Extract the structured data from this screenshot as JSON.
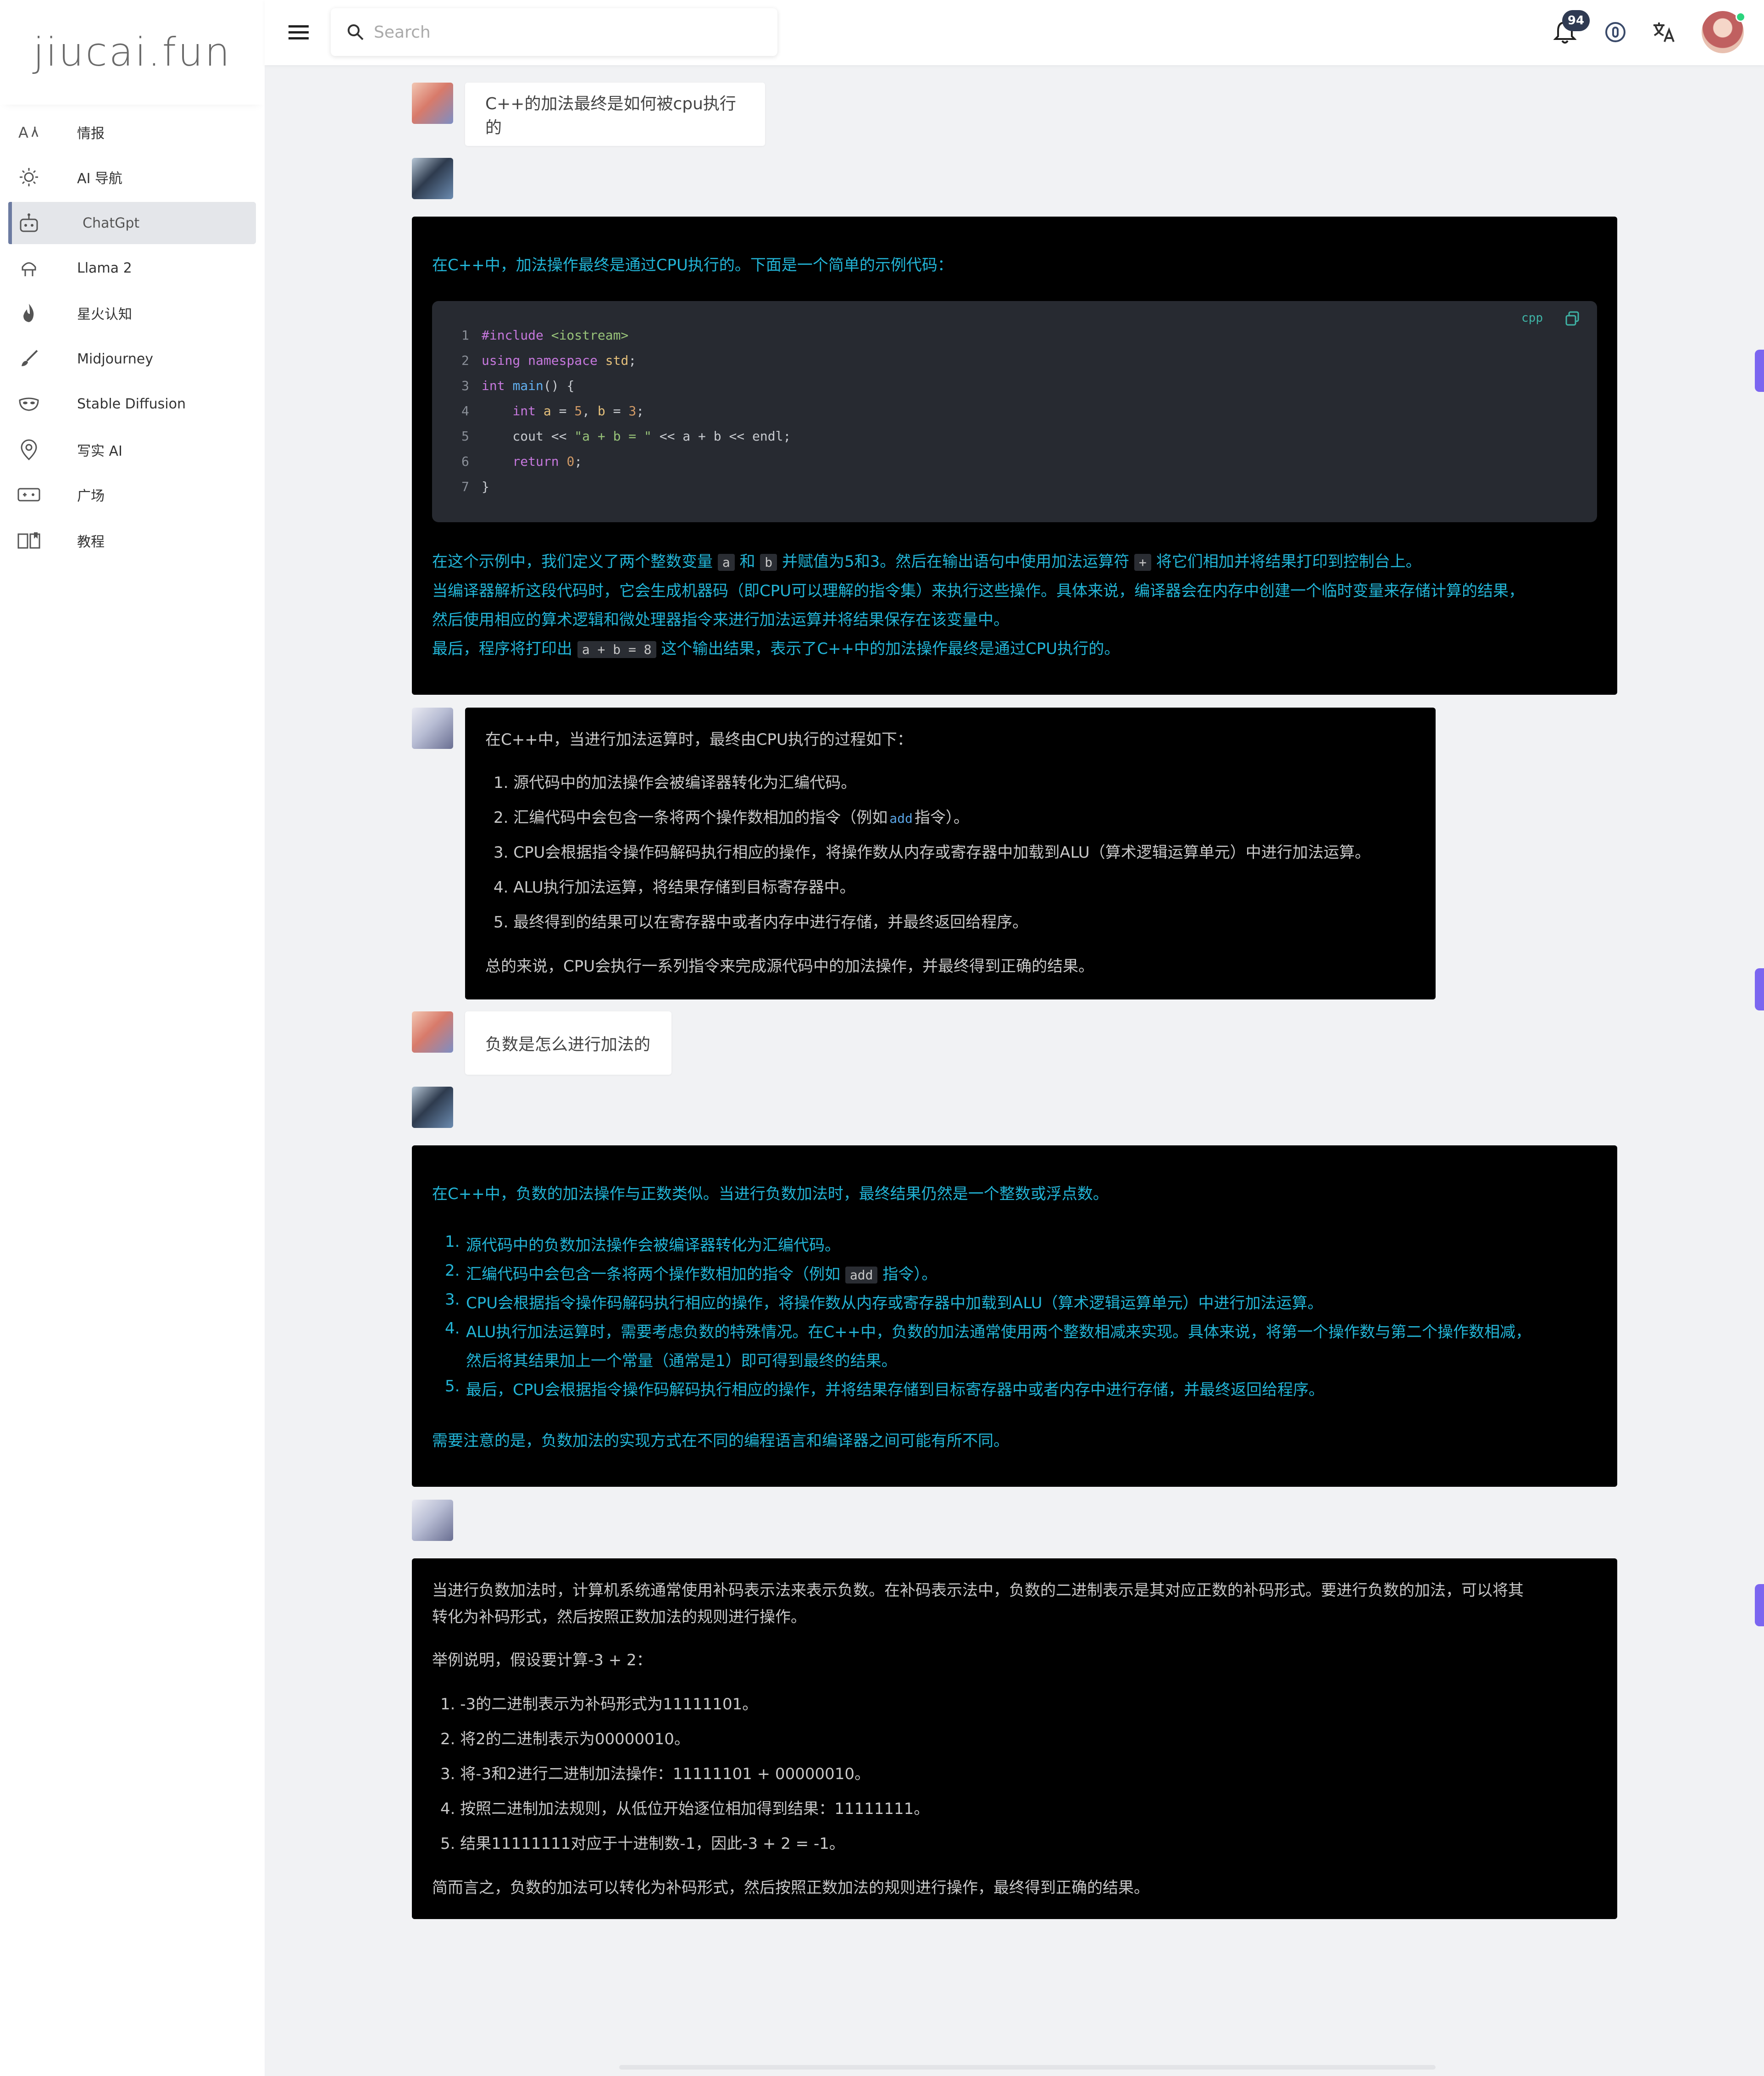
{
  "app": {
    "logo": "jiucai.fun"
  },
  "sidebar": {
    "items": [
      {
        "label": "情报",
        "icon": "text-transform-icon"
      },
      {
        "label": "AI 导航",
        "icon": "sun-gear-icon"
      },
      {
        "label": "ChatGpt",
        "icon": "robot-icon",
        "active": true
      },
      {
        "label": "Llama 2",
        "icon": "llama-icon"
      },
      {
        "label": "星火认知",
        "icon": "flame-icon"
      },
      {
        "label": "Midjourney",
        "icon": "brush-icon"
      },
      {
        "label": "Stable Diffusion",
        "icon": "mask-icon"
      },
      {
        "label": "写实 AI",
        "icon": "pin-brain-icon"
      },
      {
        "label": "广场",
        "icon": "gamepad-icon"
      },
      {
        "label": "教程",
        "icon": "book-icon"
      }
    ]
  },
  "topbar": {
    "search_placeholder": "Search",
    "notifications_count": "94",
    "accent": "#7b66f0"
  },
  "messages": {
    "q1": "C++的加法最终是如何被cpu执行的",
    "a1": {
      "intro": "在C++中，加法操作最终是通过CPU执行的。下面是一个简单的示例代码：",
      "code_lang": "cpp",
      "code_lines": [
        "#include <iostream>",
        "using namespace std;",
        "int main() {",
        "    int a = 5, b = 3;",
        "    cout << \"a + b = \" << a + b << endl;",
        "    return 0;",
        "}"
      ],
      "p1_before": "在这个示例中，我们定义了两个整数变量",
      "p1_code_a": "a",
      "p1_and": "和",
      "p1_code_b": "b",
      "p1_mid": "并赋值为5和3。然后在输出语句中使用加法运算符",
      "p1_code_plus": "+",
      "p1_after": "将它们相加并将结果打印到控制台上。",
      "p2": "当编译器解析这段代码时，它会生成机器码（即CPU可以理解的指令集）来执行这些操作。具体来说，编译器会在内存中创建一个临时变量来存储计算的结果，",
      "p3": "然后使用相应的算术逻辑和微处理器指令来进行加法运算并将结果保存在该变量中。",
      "p4_before": "最后，程序将打印出",
      "p4_code": "a + b = 8",
      "p4_after": "这个输出结果，表示了C++中的加法操作最终是通过CPU执行的。"
    },
    "a2": {
      "intro": "在C++中，当进行加法运算时，最终由CPU执行的过程如下：",
      "items": [
        "1. 源代码中的加法操作会被编译器转化为汇编代码。",
        "2. 汇编代码中会包含一条将两个操作数相加的指令（例如",
        "3. CPU会根据指令操作码解码执行相应的操作，将操作数从内存或寄存器中加载到ALU（算术逻辑运算单元）中进行加法运算。",
        "4. ALU执行加法运算，将结果存储到目标寄存器中。",
        "5. 最终得到的结果可以在寄存器中或者内存中进行存储，并最终返回给程序。"
      ],
      "item2_code": "add",
      "item2_after": "指令）。",
      "summary": "总的来说，CPU会执行一系列指令来完成源代码中的加法操作，并最终得到正确的结果。"
    },
    "q2": "负数是怎么进行加法的",
    "a3": {
      "intro": "在C++中，负数的加法操作与正数类似。当进行负数加法时，最终结果仍然是一个整数或浮点数。",
      "n1": "1.",
      "i1": "源代码中的负数加法操作会被编译器转化为汇编代码。",
      "n2": "2.",
      "i2_before": "汇编代码中会包含一条将两个操作数相加的指令（例如",
      "i2_code": "add",
      "i2_after": "指令）。",
      "n3": "3.",
      "i3": "CPU会根据指令操作码解码执行相应的操作，将操作数从内存或寄存器中加载到ALU（算术逻辑运算单元）中进行加法运算。",
      "n4": "4.",
      "i4a": "ALU执行加法运算时，需要考虑负数的特殊情况。在C++中，负数的加法通常使用两个整数相减来实现。具体来说，将第一个操作数与第二个操作数相减，",
      "i4b": "然后将其结果加上一个常量（通常是1）即可得到最终的结果。",
      "n5": "5.",
      "i5": "最后，CPU会根据指令操作码解码执行相应的操作，并将结果存储到目标寄存器中或者内存中进行存储，并最终返回给程序。",
      "note": "需要注意的是，负数加法的实现方式在不同的编程语言和编译器之间可能有所不同。"
    },
    "a4": {
      "p1a": "当进行负数加法时，计算机系统通常使用补码表示法来表示负数。在补码表示法中，负数的二进制表示是其对应正数的补码形式。要进行负数的加法，可以将其",
      "p1b": "转化为补码形式，然后按照正数加法的规则进行操作。",
      "p2": "举例说明，假设要计算-3 + 2：",
      "items": [
        "1. -3的二进制表示为补码形式为11111101。",
        "2. 将2的二进制表示为00000010。",
        "3. 将-3和2进行二进制加法操作：11111101 + 00000010。",
        "4. 按照二进制加法规则，从低位开始逐位相加得到结果：11111111。",
        "5. 结果11111111对应于十进制数-1，因此-3 + 2 = -1。"
      ],
      "summary": "简而言之，负数的加法可以转化为补码形式，然后按照正数加法的规则进行操作，最终得到正确的结果。"
    }
  }
}
